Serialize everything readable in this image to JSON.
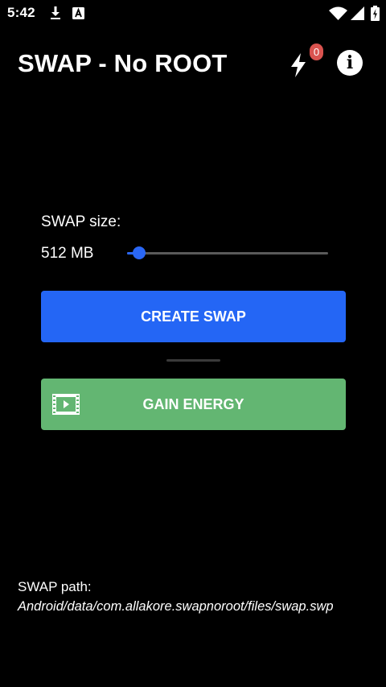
{
  "status_bar": {
    "time": "5:42",
    "icons": [
      "download-icon",
      "font-badge-icon",
      "wifi-icon",
      "signal-icon",
      "battery-icon"
    ]
  },
  "app_bar": {
    "title": "SWAP - No ROOT",
    "energy_count": "0",
    "icons": [
      "lightning-icon",
      "info-icon"
    ]
  },
  "swap": {
    "size_label": "SWAP size:",
    "size_value": "512 MB",
    "slider_fraction": 0.06
  },
  "buttons": {
    "create": "CREATE SWAP",
    "gain": "GAIN ENERGY"
  },
  "path": {
    "label": "SWAP path:",
    "value": "Android/data/com.allakore.swapnoroot/files/swap.swp"
  },
  "colors": {
    "background": "#000000",
    "accent_blue": "#2466f5",
    "energy_green": "#63b672",
    "badge_red": "#d9534f"
  }
}
